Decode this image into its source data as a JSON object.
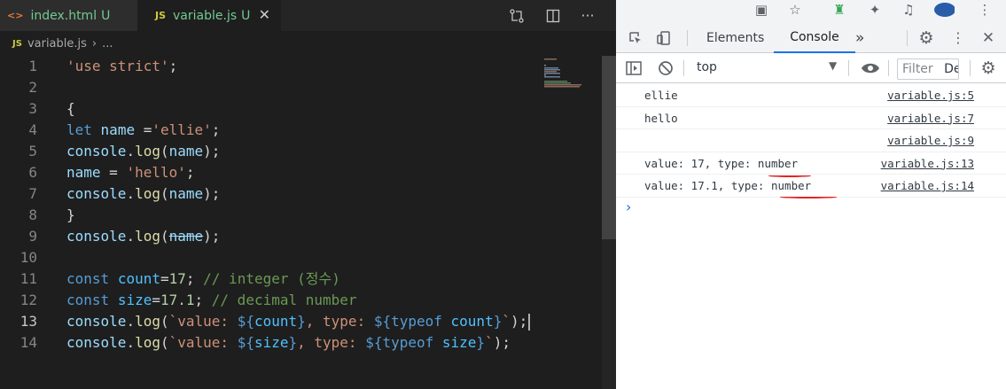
{
  "editor": {
    "tabs": [
      {
        "icon": "<>",
        "name": "index.html",
        "status": "U"
      },
      {
        "icon": "JS",
        "name": "variable.js",
        "status": "U"
      }
    ],
    "breadcrumb": {
      "icon": "JS",
      "file": "variable.js",
      "rest": "..."
    },
    "current_line": 13
  },
  "devtools": {
    "tabs": [
      "Elements",
      "Console"
    ],
    "active_tab": "Console",
    "more_tabs": "»",
    "context": "top",
    "filter_placeholder": "Filter",
    "levels_cutoff": "De",
    "logs": [
      {
        "message": "ellie",
        "source": "variable.js:5"
      },
      {
        "message": "hello",
        "source": "variable.js:7"
      },
      {
        "message": "",
        "source": "variable.js:9"
      },
      {
        "message": "value: 17, type: number",
        "source": "variable.js:13"
      },
      {
        "message": "value: 17.1, type: number",
        "source": "variable.js:14"
      }
    ],
    "prompt": "›"
  },
  "code_lines": [
    {
      "n": "1",
      "segments": [
        {
          "t": "'use strict'",
          "c": "#ce9178"
        },
        {
          "t": ";",
          "c": "#d4d4d4"
        }
      ]
    },
    {
      "n": "2",
      "segments": []
    },
    {
      "n": "3",
      "segments": [
        {
          "t": "{",
          "c": "#d4d4d4"
        }
      ]
    },
    {
      "n": "4",
      "segments": [
        {
          "t": "let",
          "c": "#569cd6"
        },
        {
          "t": " ",
          "c": "#d4d4d4"
        },
        {
          "t": "name",
          "c": "#9cdcfe"
        },
        {
          "t": " =",
          "c": "#d4d4d4"
        },
        {
          "t": "'ellie'",
          "c": "#ce9178"
        },
        {
          "t": ";",
          "c": "#d4d4d4"
        }
      ]
    },
    {
      "n": "5",
      "segments": [
        {
          "t": "console",
          "c": "#9cdcfe"
        },
        {
          "t": ".",
          "c": "#d4d4d4"
        },
        {
          "t": "log",
          "c": "#dcdcaa"
        },
        {
          "t": "(",
          "c": "#d4d4d4"
        },
        {
          "t": "name",
          "c": "#9cdcfe"
        },
        {
          "t": ");",
          "c": "#d4d4d4"
        }
      ]
    },
    {
      "n": "6",
      "segments": [
        {
          "t": "name",
          "c": "#9cdcfe"
        },
        {
          "t": " = ",
          "c": "#d4d4d4"
        },
        {
          "t": "'hello'",
          "c": "#ce9178"
        },
        {
          "t": ";",
          "c": "#d4d4d4"
        }
      ]
    },
    {
      "n": "7",
      "segments": [
        {
          "t": "console",
          "c": "#9cdcfe"
        },
        {
          "t": ".",
          "c": "#d4d4d4"
        },
        {
          "t": "log",
          "c": "#dcdcaa"
        },
        {
          "t": "(",
          "c": "#d4d4d4"
        },
        {
          "t": "name",
          "c": "#9cdcfe"
        },
        {
          "t": ");",
          "c": "#d4d4d4"
        }
      ]
    },
    {
      "n": "8",
      "segments": [
        {
          "t": "}",
          "c": "#d4d4d4"
        }
      ]
    },
    {
      "n": "9",
      "segments": [
        {
          "t": "console",
          "c": "#9cdcfe"
        },
        {
          "t": ".",
          "c": "#d4d4d4"
        },
        {
          "t": "log",
          "c": "#dcdcaa"
        },
        {
          "t": "(",
          "c": "#d4d4d4"
        },
        {
          "t": "name",
          "c": "#9cdcfe",
          "strike": true
        },
        {
          "t": ");",
          "c": "#d4d4d4"
        }
      ]
    },
    {
      "n": "10",
      "segments": []
    },
    {
      "n": "11",
      "segments": [
        {
          "t": "const",
          "c": "#569cd6"
        },
        {
          "t": " ",
          "c": "#d4d4d4"
        },
        {
          "t": "count",
          "c": "#4fc1ff"
        },
        {
          "t": "=",
          "c": "#d4d4d4"
        },
        {
          "t": "17",
          "c": "#b5cea8"
        },
        {
          "t": "; ",
          "c": "#d4d4d4"
        },
        {
          "t": "// integer (정수)",
          "c": "#6a9955"
        }
      ]
    },
    {
      "n": "12",
      "segments": [
        {
          "t": "const",
          "c": "#569cd6"
        },
        {
          "t": " ",
          "c": "#d4d4d4"
        },
        {
          "t": "size",
          "c": "#4fc1ff"
        },
        {
          "t": "=",
          "c": "#d4d4d4"
        },
        {
          "t": "17.1",
          "c": "#b5cea8"
        },
        {
          "t": "; ",
          "c": "#d4d4d4"
        },
        {
          "t": "// decimal number",
          "c": "#6a9955"
        }
      ]
    },
    {
      "n": "13",
      "segments": [
        {
          "t": "console",
          "c": "#9cdcfe"
        },
        {
          "t": ".",
          "c": "#d4d4d4"
        },
        {
          "t": "log",
          "c": "#dcdcaa"
        },
        {
          "t": "(",
          "c": "#d4d4d4"
        },
        {
          "t": "`value: ",
          "c": "#ce9178"
        },
        {
          "t": "${",
          "c": "#569cd6"
        },
        {
          "t": "count",
          "c": "#4fc1ff"
        },
        {
          "t": "}",
          "c": "#569cd6"
        },
        {
          "t": ", type: ",
          "c": "#ce9178"
        },
        {
          "t": "${",
          "c": "#569cd6"
        },
        {
          "t": "typeof",
          "c": "#569cd6"
        },
        {
          "t": " ",
          "c": "#d4d4d4"
        },
        {
          "t": "count",
          "c": "#4fc1ff"
        },
        {
          "t": "}",
          "c": "#569cd6"
        },
        {
          "t": "`",
          "c": "#ce9178"
        },
        {
          "t": ");",
          "c": "#d4d4d4"
        }
      ]
    },
    {
      "n": "14",
      "segments": [
        {
          "t": "console",
          "c": "#9cdcfe"
        },
        {
          "t": ".",
          "c": "#d4d4d4"
        },
        {
          "t": "log",
          "c": "#dcdcaa"
        },
        {
          "t": "(",
          "c": "#d4d4d4"
        },
        {
          "t": "`value: ",
          "c": "#ce9178"
        },
        {
          "t": "${",
          "c": "#569cd6"
        },
        {
          "t": "size",
          "c": "#4fc1ff"
        },
        {
          "t": "}",
          "c": "#569cd6"
        },
        {
          "t": ", type: ",
          "c": "#ce9178"
        },
        {
          "t": "${",
          "c": "#569cd6"
        },
        {
          "t": "typeof",
          "c": "#569cd6"
        },
        {
          "t": " ",
          "c": "#d4d4d4"
        },
        {
          "t": "size",
          "c": "#4fc1ff"
        },
        {
          "t": "}",
          "c": "#569cd6"
        },
        {
          "t": "`",
          "c": "#ce9178"
        },
        {
          "t": ");",
          "c": "#d4d4d4"
        }
      ]
    }
  ]
}
